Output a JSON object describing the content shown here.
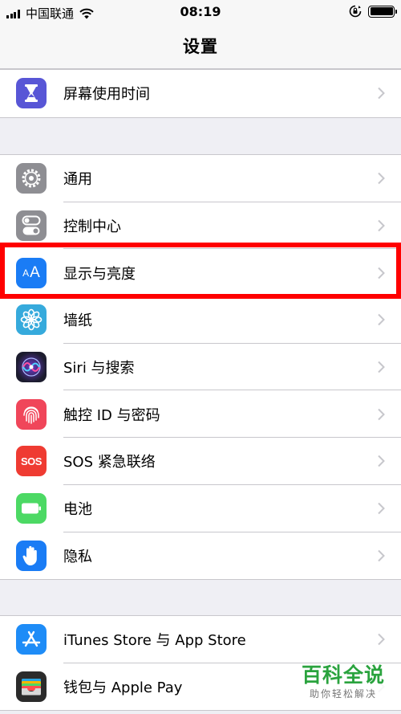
{
  "status_bar": {
    "carrier": "中国联通",
    "time": "08:19"
  },
  "nav": {
    "title": "设置"
  },
  "groups": [
    {
      "items": [
        {
          "label": "屏幕使用时间",
          "icon": "hourglass-icon",
          "color": "#5856d6"
        }
      ]
    },
    {
      "items": [
        {
          "label": "通用",
          "icon": "gear-icon",
          "color": "#8e8e93"
        },
        {
          "label": "控制中心",
          "icon": "toggles-icon",
          "color": "#8e8e93"
        },
        {
          "label": "显示与亮度",
          "icon": "text-size-icon",
          "color": "#1a7cf5",
          "highlighted": true
        },
        {
          "label": "墙纸",
          "icon": "flower-icon",
          "color": "#36aadc"
        },
        {
          "label": "Siri 与搜索",
          "icon": "siri-icon",
          "color": "#1c1c2e"
        },
        {
          "label": "触控 ID 与密码",
          "icon": "fingerprint-icon",
          "color": "#f0465a"
        },
        {
          "label": "SOS 紧急联络",
          "icon": "sos-icon",
          "color": "#ef3b32",
          "icon_text": "SOS"
        },
        {
          "label": "电池",
          "icon": "battery-icon",
          "color": "#4cd964"
        },
        {
          "label": "隐私",
          "icon": "hand-icon",
          "color": "#1a7cf5"
        }
      ]
    },
    {
      "items": [
        {
          "label": "iTunes Store 与 App Store",
          "icon": "app-store-icon",
          "color": "#1e8cf7"
        },
        {
          "label": "钱包与 Apple Pay",
          "icon": "wallet-icon",
          "color": "#2b2b2b"
        }
      ]
    }
  ],
  "watermark": {
    "title": "百科全说",
    "subtitle": "助你轻松解决"
  }
}
